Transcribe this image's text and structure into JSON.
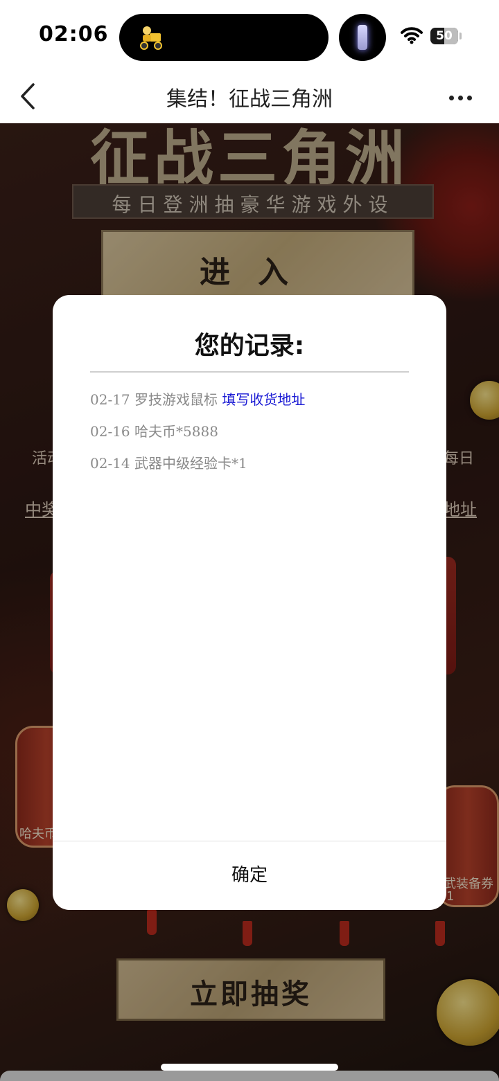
{
  "status_bar": {
    "time": "02:06",
    "battery": "50"
  },
  "nav": {
    "title": "集结！征战三角洲"
  },
  "game": {
    "big_title": "征战三角洲",
    "subtitle": "每日登洲抽豪华游戏外设",
    "enter_label": "进入",
    "left_side_text": "活动",
    "right_side_text": "每日",
    "left_link": "中奖",
    "right_link": "地址",
    "lantern_left_label": "哈夫币",
    "lantern_right_label": "武装备券",
    "lantern_right_count": "1",
    "draw_label": "立即抽奖"
  },
  "modal": {
    "title": "您的记录:",
    "records": [
      {
        "date": "02-17",
        "prize": "罗技游戏鼠标",
        "link": "填写收货地址"
      },
      {
        "date": "02-16",
        "prize": "哈夫币*5888"
      },
      {
        "date": "02-14",
        "prize": "武器中级经验卡*1"
      }
    ],
    "confirm_label": "确定"
  }
}
